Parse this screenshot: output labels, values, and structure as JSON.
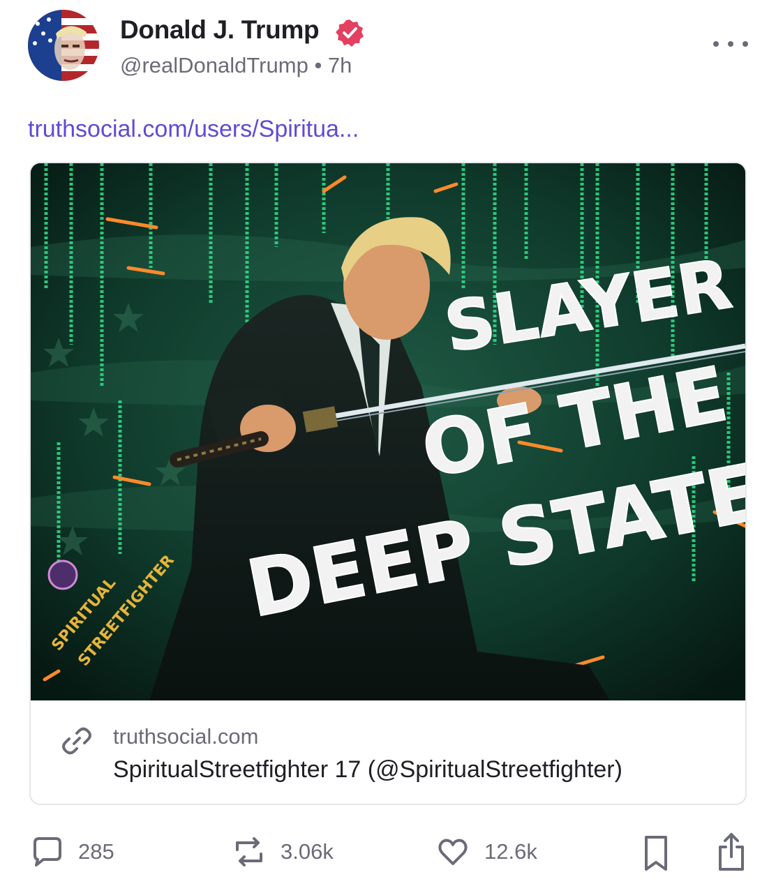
{
  "post": {
    "author": {
      "name": "Donald J. Trump",
      "handle": "@realDonaldTrump",
      "time_ago": "7h",
      "verified": true,
      "avatar_icon": "avatar-flag-portrait"
    },
    "link_text": "truthsocial.com/users/Spiritua...",
    "card": {
      "image_text": {
        "line1": "SLAYER",
        "line2": "OF THE",
        "line3": "DEEP STATE",
        "watermark_line1": "SPIRITUAL",
        "watermark_line2": "STREETFIGHTER"
      },
      "domain": "truthsocial.com",
      "title": "SpiritualStreetfighter 17 (@SpiritualStreetfighter)",
      "link_icon": "link-icon"
    },
    "actions": {
      "replies": "285",
      "reposts": "3.06k",
      "likes": "12.6k"
    }
  },
  "colors": {
    "link": "#5f4bd4",
    "verified_badge": "#e4405f",
    "muted_text": "#6b6b78",
    "matrix_green": "#2fe08a"
  }
}
